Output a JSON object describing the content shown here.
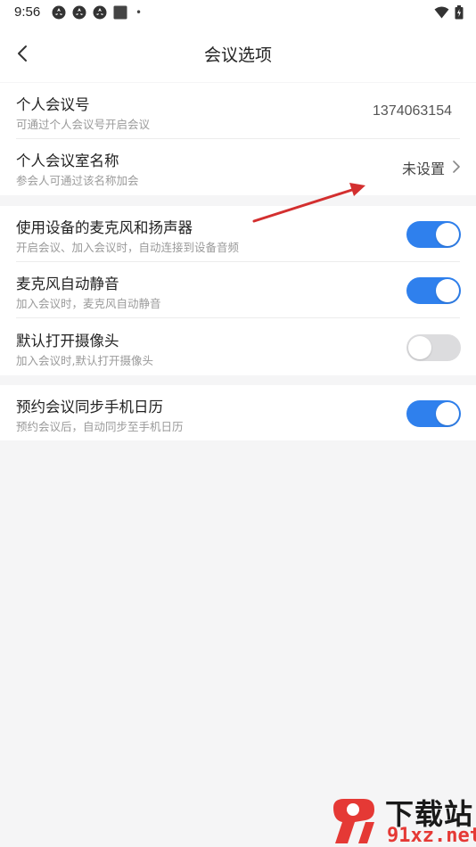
{
  "status_bar": {
    "time": "9:56",
    "dot": "•",
    "icons": [
      "app-notification-icon",
      "app-notification-icon",
      "app-notification-icon",
      "image-notification-icon",
      "wifi-icon",
      "battery-icon"
    ]
  },
  "header": {
    "title": "会议选项",
    "back_icon": "chevron-left-icon"
  },
  "account_section": {
    "personal_meeting_id": {
      "title": "个人会议号",
      "subtitle": "可通过个人会议号开启会议",
      "value": "1374063154"
    },
    "personal_room_name": {
      "title": "个人会议室名称",
      "subtitle": "参会人可通过该名称加会",
      "value": "未设置"
    }
  },
  "audio_section": {
    "use_device_audio": {
      "title": "使用设备的麦克风和扬声器",
      "subtitle": "开启会议、加入会议时，自动连接到设备音频",
      "enabled": true
    },
    "auto_mute_mic": {
      "title": "麦克风自动静音",
      "subtitle": "加入会议时，麦克风自动静音",
      "enabled": true
    },
    "default_camera_on": {
      "title": "默认打开摄像头",
      "subtitle": "加入会议时,默认打开摄像头",
      "enabled": false
    }
  },
  "calendar_section": {
    "sync_calendar": {
      "title": "预约会议同步手机日历",
      "subtitle": "预约会议后，自动同步至手机日历",
      "enabled": true
    }
  },
  "colors": {
    "toggle_on": "#2f80ed",
    "toggle_off": "#dcdcde",
    "annotation_arrow": "#d32f2f"
  },
  "watermark": {
    "brand": "下载站",
    "url": "91xz.net"
  }
}
